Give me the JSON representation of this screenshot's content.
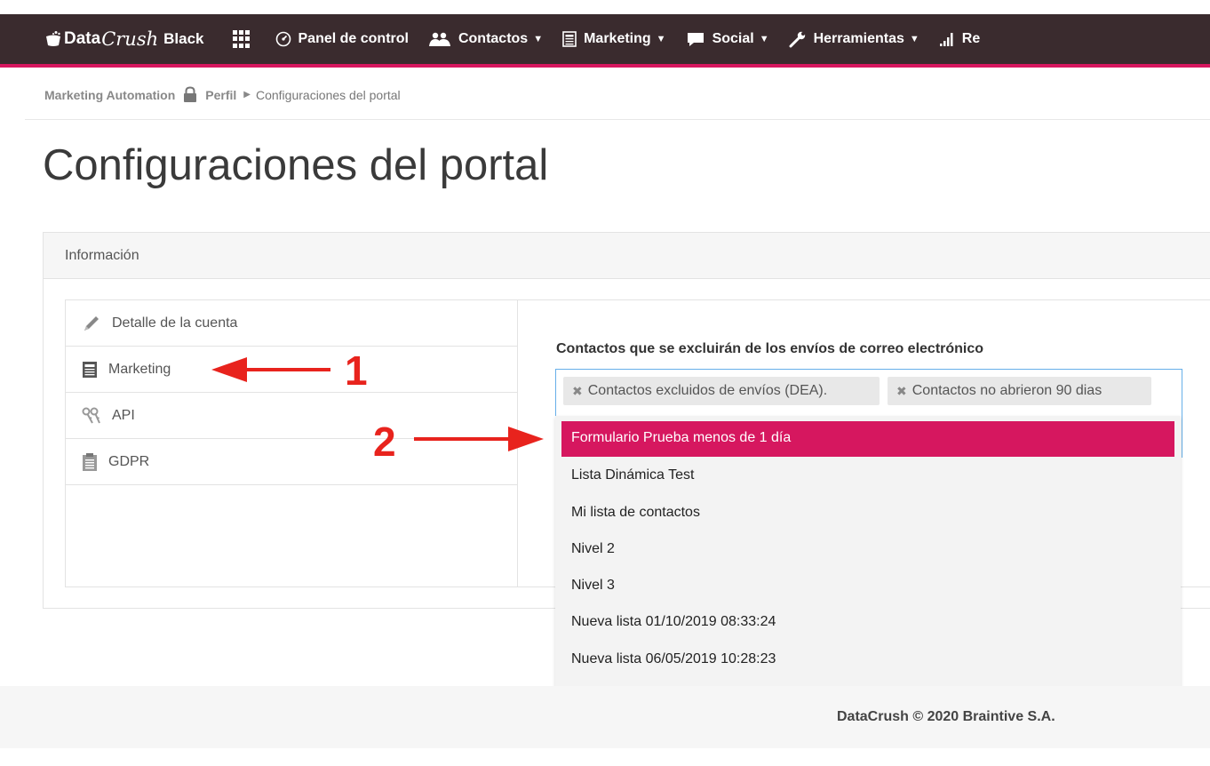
{
  "app": {
    "logo_data": "Data",
    "logo_crush": "Crush",
    "logo_black": "Black"
  },
  "nav": {
    "items": [
      {
        "label": "Panel de control",
        "icon": "dashboard-icon",
        "caret": false
      },
      {
        "label": "Contactos",
        "icon": "users-icon",
        "caret": true
      },
      {
        "label": "Marketing",
        "icon": "newspaper-icon",
        "caret": true
      },
      {
        "label": "Social",
        "icon": "comment-icon",
        "caret": true
      },
      {
        "label": "Herramientas",
        "icon": "wrench-icon",
        "caret": true
      },
      {
        "label": "Re",
        "icon": "signal-icon",
        "caret": false
      }
    ]
  },
  "breadcrumb": {
    "root": "Marketing Automation",
    "profile": "Perfil",
    "current": "Configuraciones del portal"
  },
  "page": {
    "title": "Configuraciones del portal"
  },
  "panel": {
    "header": "Información",
    "menu": [
      {
        "label": "Detalle de la cuenta",
        "icon": "pencil-icon"
      },
      {
        "label": "Marketing",
        "icon": "newspaper-icon"
      },
      {
        "label": "API",
        "icon": "keys-icon"
      },
      {
        "label": "GDPR",
        "icon": "clipboard-icon"
      }
    ]
  },
  "exclusion": {
    "label": "Contactos que se excluirán de los envíos de correo electrónico",
    "tags": [
      "Contactos excluidos de envíos (DEA).",
      "Contactos no abrieron 90 dias"
    ],
    "options": [
      "Formulario Prueba menos de 1 día",
      "Lista Dinámica Test",
      "Mi lista de contactos",
      "Nivel 2",
      "Nivel 3",
      "Nueva lista 01/10/2019 08:33:24",
      "Nueva lista 06/05/2019 10:28:23"
    ],
    "highlighted_option": "Formulario Prueba menos de 1 día"
  },
  "annotations": {
    "one": "1",
    "two": "2"
  },
  "footer": {
    "text": "DataCrush © 2020 Braintive S.A."
  },
  "colors": {
    "topbar": "#3a2b2e",
    "accent": "#d6175f",
    "annotation": "#e8231d"
  }
}
